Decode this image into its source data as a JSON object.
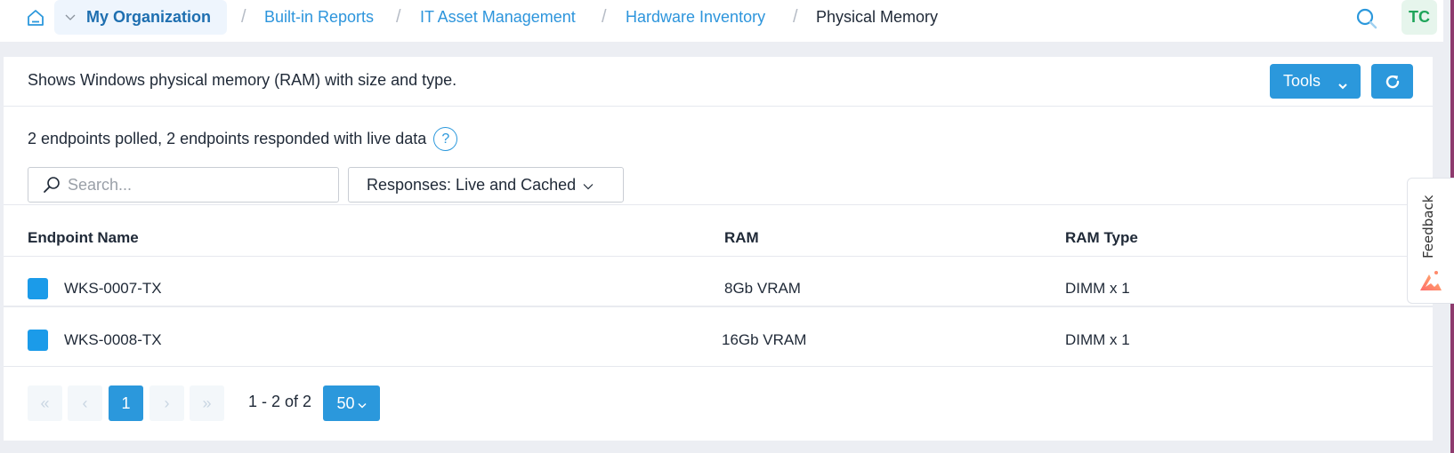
{
  "header": {
    "home_icon": "home-icon",
    "organization": "My Organization",
    "breadcrumbs": [
      {
        "label": "Built-in Reports",
        "link": true
      },
      {
        "label": "IT Asset Management",
        "link": true
      },
      {
        "label": "Hardware Inventory",
        "link": true
      },
      {
        "label": "Physical Memory",
        "link": false
      }
    ],
    "separator": "/",
    "search_icon": "search-icon",
    "user_initials": "TC"
  },
  "report": {
    "description": "Shows Windows physical memory (RAM) with size and type.",
    "tools_label": "Tools",
    "refresh_icon": "refresh-icon",
    "status_text": "2 endpoints polled, 2 endpoints responded with live data",
    "help_glyph": "?"
  },
  "filters": {
    "search_placeholder": "Search...",
    "search_value": "",
    "responses_label": "Responses: Live and Cached"
  },
  "table": {
    "columns": [
      "Endpoint Name",
      "RAM",
      "RAM Type"
    ],
    "rows": [
      {
        "endpoint": "WKS-0007-TX",
        "ram": "8Gb VRAM",
        "ram_type": "DIMM x 1"
      },
      {
        "endpoint": "WKS-0008-TX",
        "ram": "16Gb VRAM",
        "ram_type": "DIMM x 1"
      }
    ]
  },
  "pagination": {
    "first": "«",
    "prev": "‹",
    "current_page": "1",
    "next": "›",
    "last": "»",
    "range_text": "1 - 2 of 2",
    "page_size": "50"
  },
  "feedback": {
    "label": "Feedback"
  },
  "colors": {
    "accent": "#2b98dc",
    "link": "#2d95dc",
    "avatar_text": "#1fa55a",
    "checkbox": "#1b9be9"
  }
}
